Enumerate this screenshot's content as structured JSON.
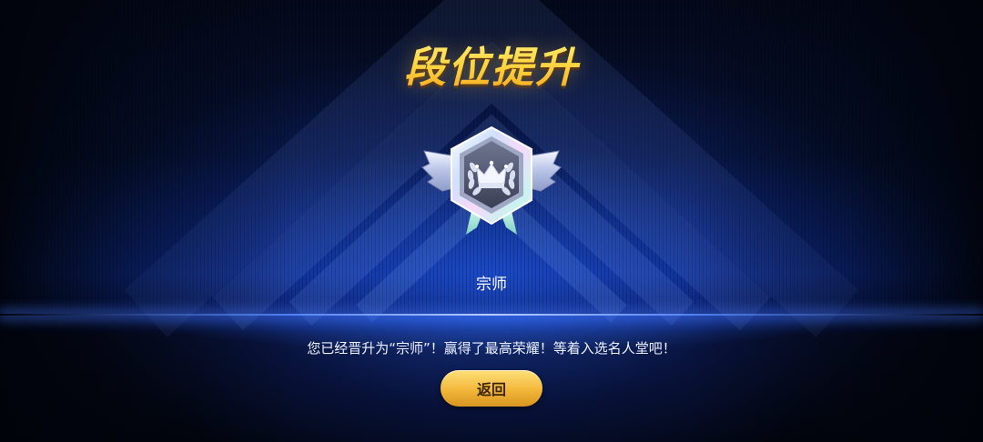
{
  "title": "段位提升",
  "rank": {
    "name": "宗师",
    "badge_icon": "grandmaster-crown-badge-icon"
  },
  "message": "您已经晋升为“宗师”！赢得了最高荣耀！等着入选名人堂吧！",
  "back_button_label": "返回",
  "colors": {
    "title_gold": "#ffd84a",
    "button_gold": "#f2b73a",
    "stage_blue": "#2b62ff",
    "background": "#02050e"
  }
}
